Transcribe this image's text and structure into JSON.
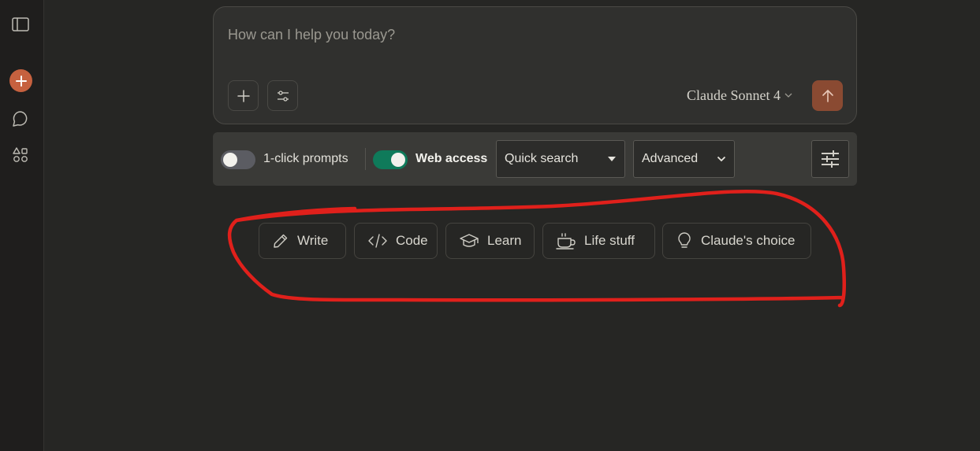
{
  "sidebar": {
    "icons": [
      "sidebar-toggle-icon",
      "plus-icon",
      "chat-bubble-icon",
      "shapes-icon"
    ],
    "accent": "#c6613f"
  },
  "composer": {
    "placeholder": "How can I help you today?",
    "model_label": "Claude Sonnet 4",
    "send_color": "#8a4a32"
  },
  "toolbar": {
    "one_click_label": "1-click prompts",
    "one_click_on": false,
    "web_access_label": "Web access",
    "web_access_on": true,
    "search_mode": "Quick search",
    "mode": "Advanced",
    "toggle_on_color": "#0f7a5a"
  },
  "chips": [
    {
      "label": "Write",
      "icon": "pencil-icon"
    },
    {
      "label": "Code",
      "icon": "code-icon"
    },
    {
      "label": "Learn",
      "icon": "graduation-cap-icon"
    },
    {
      "label": "Life stuff",
      "icon": "coffee-cup-icon"
    },
    {
      "label": "Claude's choice",
      "icon": "lightbulb-icon"
    }
  ],
  "annotation": {
    "color": "#e0201b"
  }
}
